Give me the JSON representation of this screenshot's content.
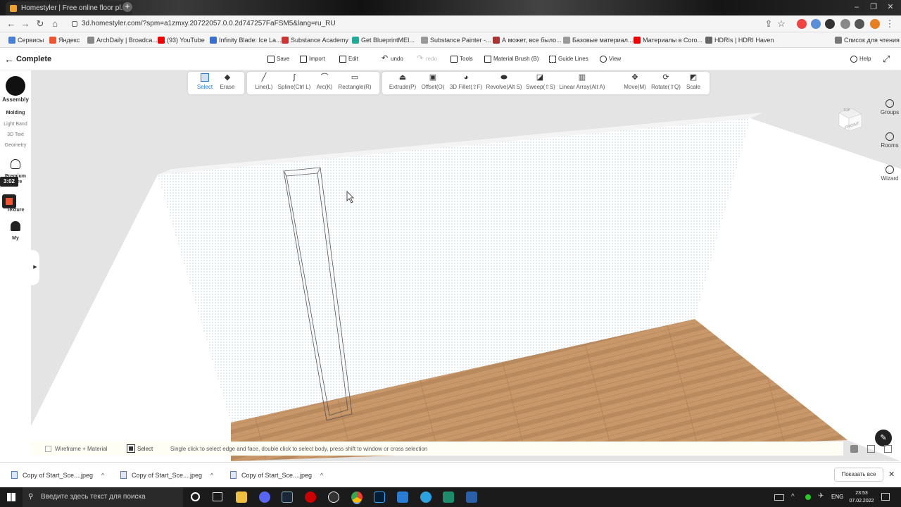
{
  "browser": {
    "tab_title": "Homestyler | Free online floor pl...",
    "url": "3d.homestyler.com/?spm=a1zmxy.20722057.0.0.2d747257FaFSM5&lang=ru_RU",
    "bookmarks": [
      "Сервисы",
      "Яндекс",
      "ArchDaily | Broadca...",
      "(93) YouTube",
      "Infinity Blade: Ice La...",
      "Substance Academy",
      "Get BlueprintMEI...",
      "Substance Painter -...",
      "А может, все было...",
      "Базовые материал...",
      "Материалы в Coro...",
      "HDRIs | HDRI Haven",
      "Список для чтения"
    ]
  },
  "app": {
    "back_label": "Complete",
    "top_actions": [
      {
        "label": "Save",
        "icon": "save-icon"
      },
      {
        "label": "Import",
        "icon": "import-icon"
      },
      {
        "label": "Edit",
        "icon": "edit-icon"
      },
      {
        "label": "undo",
        "icon": "undo-icon"
      },
      {
        "label": "redo",
        "icon": "redo-icon"
      },
      {
        "label": "Tools",
        "icon": "tools-icon"
      },
      {
        "label": "Material Brush (B)",
        "icon": "brush-icon"
      },
      {
        "label": "Guide Lines",
        "icon": "guide-lines-icon"
      },
      {
        "label": "View",
        "icon": "eye-icon"
      }
    ],
    "help_label": "Help",
    "tools_group1": [
      "Select",
      "Erase"
    ],
    "tools_group2": [
      "Line(L)",
      "Spline(Ctrl L)",
      "Arc(K)",
      "Rectangle(R)"
    ],
    "tools_group3": [
      "Extrude(P)",
      "Offset(O)",
      "3D Fillet(⇧F)",
      "Revolve(Alt S)",
      "Sweep(⇧S)",
      "Linear Array(Alt A)",
      "Move(M)",
      "Rotate(⇧Q)",
      "Scale"
    ],
    "left_sidebar": {
      "assembly": "Assembly",
      "items": [
        "Molding",
        "Light Band",
        "3D Text",
        "Geometry"
      ],
      "premium": "Premium",
      "premium2": "ure",
      "texture": "Texture",
      "my": "My",
      "timer": "3:02"
    },
    "right_sidebar": [
      "Groups",
      "Rooms",
      "Wizard"
    ],
    "viewcube": {
      "top": "TOP",
      "front": "FRONT"
    },
    "status": {
      "mode": "Wireframe + Material",
      "tool": "Select",
      "hint": "Single click to select edge and face, double click to select body, press shift to window or cross selection"
    }
  },
  "downloads": {
    "items": [
      "Copy of Start_Sce....jpeg",
      "Copy of Start_Sce....jpeg",
      "Copy of Start_Sce....jpeg"
    ],
    "show_all": "Показать все"
  },
  "taskbar": {
    "search_placeholder": "Введите здесь текст для поиска",
    "lang": "ENG",
    "time": "23:53",
    "date": "07.02.2022"
  },
  "colors": {
    "floor": "#c89a68",
    "wall": "#ffffff",
    "accent": "#2b78d6"
  }
}
